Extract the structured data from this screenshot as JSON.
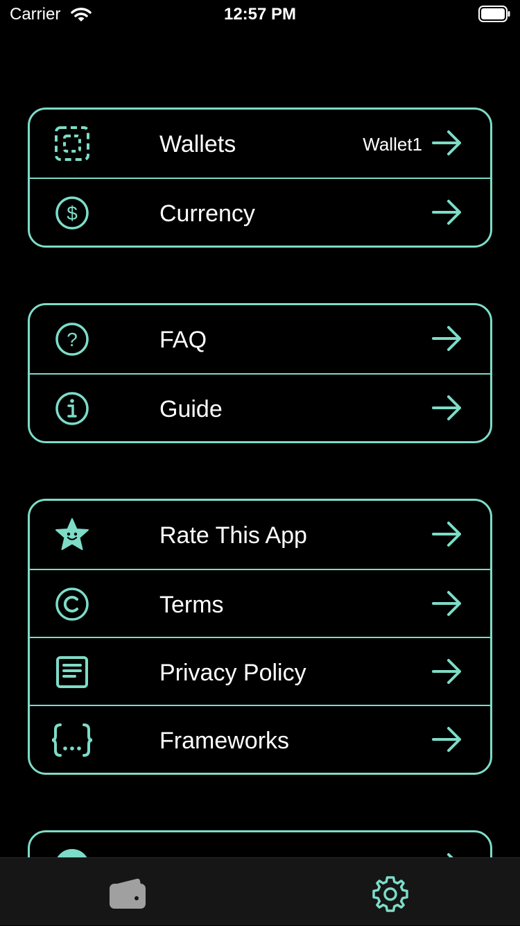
{
  "status_bar": {
    "carrier": "Carrier",
    "time": "12:57 PM"
  },
  "colors": {
    "accent": "#7ddcc8",
    "background": "#000000",
    "tab_bar": "#161616",
    "inactive_tab_icon": "#a0a0a0"
  },
  "groups": [
    {
      "rows": [
        {
          "icon": "wallet-dashed-icon",
          "label": "Wallets",
          "value": "Wallet1"
        },
        {
          "icon": "dollar-circle-icon",
          "label": "Currency"
        }
      ]
    },
    {
      "rows": [
        {
          "icon": "question-circle-icon",
          "label": "FAQ"
        },
        {
          "icon": "info-circle-icon",
          "label": "Guide"
        }
      ]
    },
    {
      "rows": [
        {
          "icon": "smiling-star-icon",
          "label": "Rate This App"
        },
        {
          "icon": "copyright-icon",
          "label": "Terms"
        },
        {
          "icon": "document-icon",
          "label": "Privacy Policy"
        },
        {
          "icon": "braces-icon",
          "label": "Frameworks"
        }
      ]
    }
  ],
  "tab_bar": {
    "tabs": [
      {
        "icon": "wallet-icon",
        "selected": false
      },
      {
        "icon": "gear-icon",
        "selected": true
      }
    ]
  }
}
